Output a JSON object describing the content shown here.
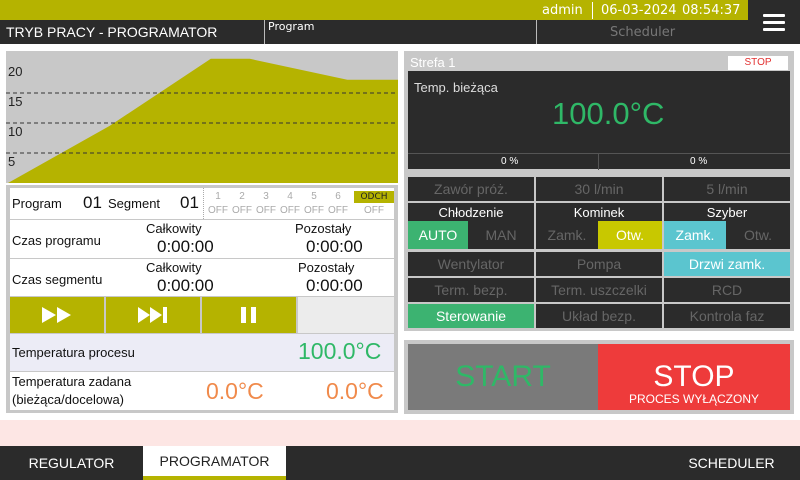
{
  "header": {
    "user": "admin",
    "date": "06-03-2024",
    "time": "08:54:37",
    "mode_title": "TRYB PRACY - PROGRAMATOR",
    "crumb_left": "Program",
    "crumb_right": "Scheduler",
    "menu_icon": "hamburger-icon"
  },
  "chart_data": {
    "type": "area",
    "x": [
      0,
      1,
      2,
      3,
      4,
      5
    ],
    "values": [
      0,
      9.5,
      20.7,
      20.7,
      17.2,
      17.2
    ],
    "y_ticks": [
      "20",
      "15",
      "10",
      "5"
    ],
    "ylim": [
      0,
      22
    ],
    "grid": "dashed",
    "fill": "#b5b300",
    "background": "#c8c8c8"
  },
  "program": {
    "program_label": "Program",
    "program_value": "01",
    "segment_label": "Segment",
    "segment_value": "01",
    "segments": [
      "1",
      "2",
      "3",
      "4",
      "5",
      "6"
    ],
    "segment_states": [
      "OFF",
      "OFF",
      "OFF",
      "OFF",
      "OFF",
      "OFF",
      "OFF"
    ],
    "odch_label": "ODCH",
    "program_time_label": "Czas programu",
    "segment_time_label": "Czas segmentu",
    "total_label": "Całkowity",
    "remaining_label": "Pozostały",
    "program_total": "0:00:00",
    "program_remaining": "0:00:00",
    "segment_total": "0:00:00",
    "segment_remaining": "0:00:00",
    "controls": [
      "play-icon",
      "skip-next-icon",
      "pause-icon"
    ],
    "process_temp_label": "Temperatura procesu",
    "process_temp": "100.0°C",
    "set_temp_label_1": "Temperatura zadana",
    "set_temp_label_2": "(bieżąca/docelowa)",
    "set_temp_current": "0.0°C",
    "set_temp_target": "0.0°C"
  },
  "zone": {
    "name": "Strefa 1",
    "stop_badge": "STOP",
    "current_label": "Temp. bieżąca",
    "current_temp": "100.0°C",
    "output_1": "0 %",
    "output_2": "0 %"
  },
  "status": {
    "valve": "Zawór próż.",
    "flow_1": "30 l/min",
    "flow_2": "5 l/min",
    "cooling": "Chłodzenie",
    "chimney": "Kominek",
    "damper": "Szyber",
    "auto": "AUTO",
    "man": "MAN",
    "chimney_closed": "Zamk.",
    "chimney_open": "Otw.",
    "damper_closed": "Zamk.",
    "damper_open": "Otw.",
    "fan": "Wentylator",
    "pump": "Pompa",
    "door": "Drzwi zamk.",
    "term_safety": "Term. bezp.",
    "term_seal": "Term. uszczelki",
    "rcd": "RCD",
    "control": "Sterowanie",
    "safety_system": "Układ bezp.",
    "phase_control": "Kontrola faz",
    "colors": {
      "green": "#3cb371",
      "olive": "#c8c800",
      "cyan": "#5bc5cf"
    }
  },
  "actions": {
    "start": "START",
    "stop": "STOP",
    "stop_status": "PROCES WYŁĄCZONY"
  },
  "tabs": {
    "regulator": "REGULATOR",
    "programator": "PROGRAMATOR",
    "scheduler": "SCHEDULER"
  }
}
